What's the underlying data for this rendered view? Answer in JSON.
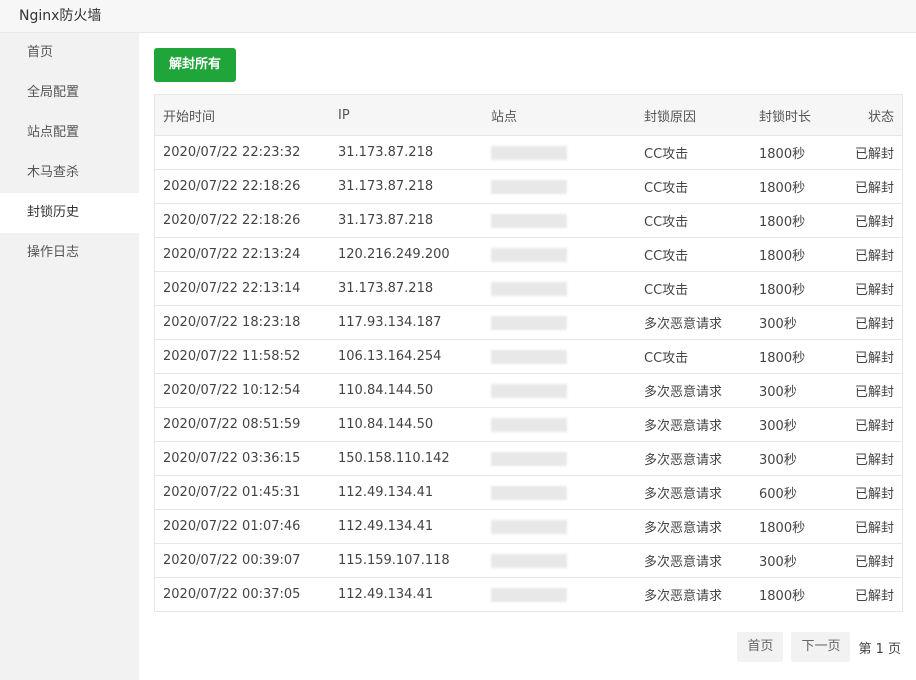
{
  "window": {
    "title": "Nginx防火墙"
  },
  "sidebar": {
    "items": [
      {
        "label": "首页",
        "active": false
      },
      {
        "label": "全局配置",
        "active": false
      },
      {
        "label": "站点配置",
        "active": false
      },
      {
        "label": "木马查杀",
        "active": false
      },
      {
        "label": "封锁历史",
        "active": true
      },
      {
        "label": "操作日志",
        "active": false
      }
    ]
  },
  "toolbar": {
    "unlock_all": "解封所有"
  },
  "table": {
    "headers": {
      "start_time": "开始时间",
      "ip": "IP",
      "site": "站点",
      "reason": "封锁原因",
      "duration": "封锁时长",
      "status": "状态"
    },
    "rows": [
      {
        "time": "2020/07/22 22:23:32",
        "ip": "31.173.87.218",
        "reason": "CC攻击",
        "duration": "1800秒",
        "status": "已解封"
      },
      {
        "time": "2020/07/22 22:18:26",
        "ip": "31.173.87.218",
        "reason": "CC攻击",
        "duration": "1800秒",
        "status": "已解封"
      },
      {
        "time": "2020/07/22 22:18:26",
        "ip": "31.173.87.218",
        "reason": "CC攻击",
        "duration": "1800秒",
        "status": "已解封"
      },
      {
        "time": "2020/07/22 22:13:24",
        "ip": "120.216.249.200",
        "reason": "CC攻击",
        "duration": "1800秒",
        "status": "已解封"
      },
      {
        "time": "2020/07/22 22:13:14",
        "ip": "31.173.87.218",
        "reason": "CC攻击",
        "duration": "1800秒",
        "status": "已解封"
      },
      {
        "time": "2020/07/22 18:23:18",
        "ip": "117.93.134.187",
        "reason": "多次恶意请求",
        "duration": "300秒",
        "status": "已解封"
      },
      {
        "time": "2020/07/22 11:58:52",
        "ip": "106.13.164.254",
        "reason": "CC攻击",
        "duration": "1800秒",
        "status": "已解封"
      },
      {
        "time": "2020/07/22 10:12:54",
        "ip": "110.84.144.50",
        "reason": "多次恶意请求",
        "duration": "300秒",
        "status": "已解封"
      },
      {
        "time": "2020/07/22 08:51:59",
        "ip": "110.84.144.50",
        "reason": "多次恶意请求",
        "duration": "300秒",
        "status": "已解封"
      },
      {
        "time": "2020/07/22 03:36:15",
        "ip": "150.158.110.142",
        "reason": "多次恶意请求",
        "duration": "300秒",
        "status": "已解封"
      },
      {
        "time": "2020/07/22 01:45:31",
        "ip": "112.49.134.41",
        "reason": "多次恶意请求",
        "duration": "600秒",
        "status": "已解封"
      },
      {
        "time": "2020/07/22 01:07:46",
        "ip": "112.49.134.41",
        "reason": "多次恶意请求",
        "duration": "1800秒",
        "status": "已解封"
      },
      {
        "time": "2020/07/22 00:39:07",
        "ip": "115.159.107.118",
        "reason": "多次恶意请求",
        "duration": "300秒",
        "status": "已解封"
      },
      {
        "time": "2020/07/22 00:37:05",
        "ip": "112.49.134.41",
        "reason": "多次恶意请求",
        "duration": "1800秒",
        "status": "已解封"
      }
    ]
  },
  "pagination": {
    "first": "首页",
    "next": "下一页",
    "info": "第 1 页"
  }
}
